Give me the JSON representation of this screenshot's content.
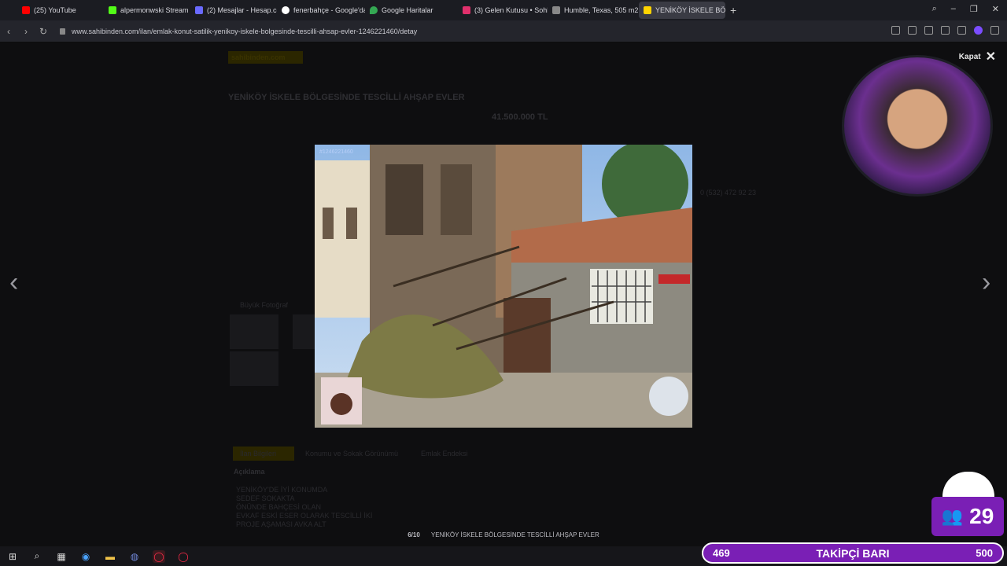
{
  "tabs": [
    {
      "label": "(25) YouTube",
      "color": "#ff0000"
    },
    {
      "label": "alpermonwski Stream - W",
      "color": "#53fc18"
    },
    {
      "label": "(2) Mesajlar - Hesap.com.",
      "color": "#6a6aff"
    },
    {
      "label": "fenerbahçe - Google'da A",
      "color": "#ffffff"
    },
    {
      "label": "Google Haritalar",
      "color": "#34a853"
    },
    {
      "label": "(3) Gelen Kutusu • Sohbet",
      "color": "#e1306c"
    },
    {
      "label": "Humble, Texas, 505 m2, sa",
      "color": "#aaaaaa"
    },
    {
      "label": "YENİKÖY İSKELE BÖLGESİ",
      "color": "#ffd400"
    }
  ],
  "url": "www.sahibinden.com/ilan/emlak-konut-satilik-yenikoy-iskele-bolgesinde-tescilli-ahsap-evler-1246221460/detay",
  "page": {
    "logo": "sahibinden.com",
    "title": "YENİKÖY İSKELE BÖLGESİNDE TESCİLLİ AHŞAP EVLER",
    "price": "41.500.000 TL",
    "phone": "0 (532) 472 92 23",
    "big_photo": "Büyük Fotoğraf",
    "tab1": "İlan Bilgileri",
    "tab2": "Konumu ve Sokak Görünümü",
    "tab3": "Emlak Endeksi",
    "desc_head": "Açıklama",
    "desc_lines": [
      "YENİKÖY'DE İYİ KONUMDA",
      "SEDEF SOKAKTA",
      "ÖNÜNDE BAHÇESİ OLAN",
      "EVKAF ESKİ ESER OLARAK TESCİLLİ İKİ",
      "PROJE AŞAMASI AVKA ALT"
    ]
  },
  "viewer": {
    "close_label": "Kapat",
    "counter": "6/10",
    "caption": "YENİKÖY İSKELE BÖLGESİNDE TESCİLLİ AHŞAP EVLER",
    "photo_id": "#1246221460"
  },
  "overlay": {
    "follower_count": "29",
    "goal_label": "TAKİPÇİ BARI",
    "goal_current": "469",
    "goal_target": "500"
  }
}
